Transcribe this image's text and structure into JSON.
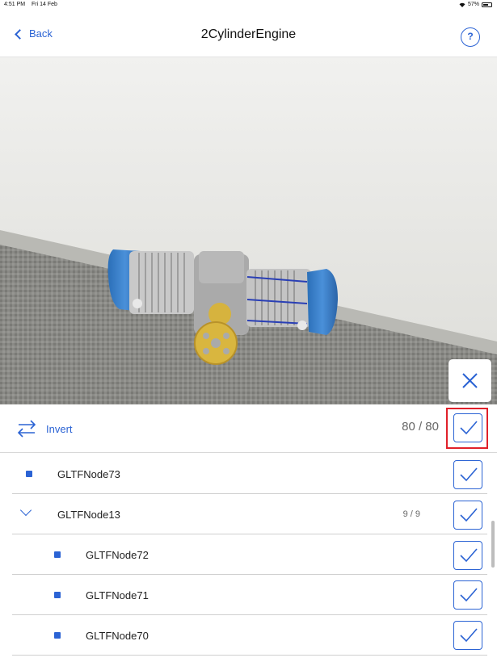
{
  "status_bar": {
    "time": "4:51 PM",
    "date": "Fri 14 Feb",
    "battery": "57%"
  },
  "nav": {
    "back_label": "Back",
    "title": "2CylinderEngine",
    "help_label": "?"
  },
  "toolbar": {
    "invert_label": "Invert",
    "count": "80 / 80"
  },
  "list": {
    "items": [
      {
        "label": "GLTFNode73",
        "count": ""
      },
      {
        "label": "GLTFNode13",
        "count": "9 / 9"
      },
      {
        "label": "GLTFNode72",
        "count": ""
      },
      {
        "label": "GLTFNode71",
        "count": ""
      },
      {
        "label": "GLTFNode70",
        "count": ""
      }
    ]
  },
  "colors": {
    "accent": "#2b63d4",
    "highlight": "#e0202a"
  }
}
